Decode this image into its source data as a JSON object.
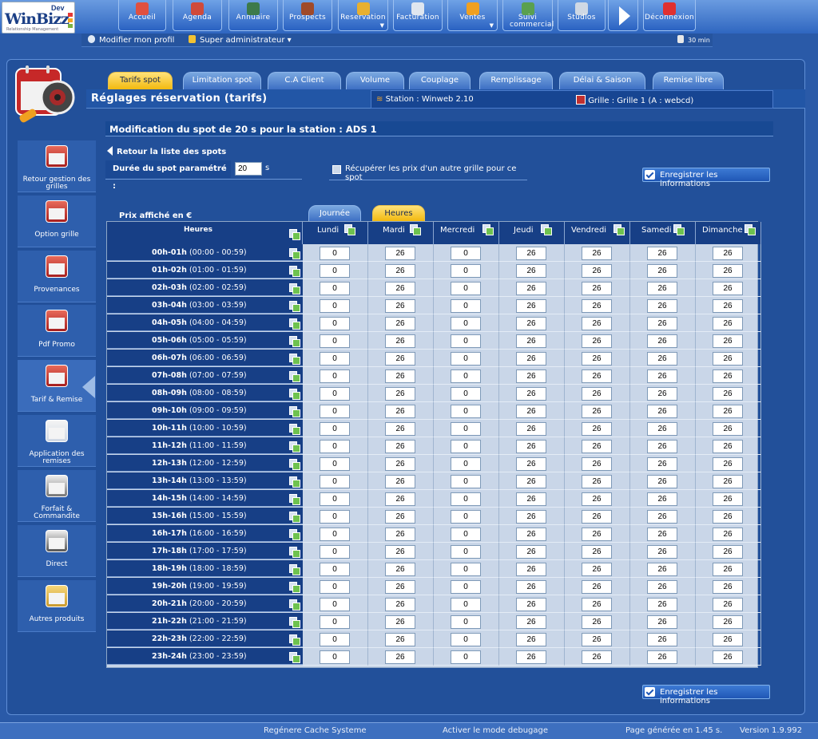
{
  "app": {
    "name": "WinBizz",
    "dev_label": "Dev",
    "tagline": "Relationship Management"
  },
  "nav": [
    {
      "label": "Accueil",
      "icon": "home-icon",
      "color": "#e05040"
    },
    {
      "label": "Agenda",
      "icon": "calendar-icon",
      "color": "#d04a3a"
    },
    {
      "label": "Annuaire",
      "icon": "address-book-icon",
      "color": "#3d7a4a"
    },
    {
      "label": "Prospects",
      "icon": "briefcase-icon",
      "color": "#a04a2a"
    },
    {
      "label": "Reservation",
      "icon": "stopwatch-icon",
      "color": "#e8b030"
    },
    {
      "label": "Facturation",
      "icon": "invoice-icon",
      "color": "#dfe6ef"
    },
    {
      "label": "Ventes",
      "icon": "sales-icon",
      "color": "#f0a020"
    },
    {
      "label": "Suivi commercial",
      "icon": "followup-icon",
      "color": "#5aa050"
    },
    {
      "label": "Studios",
      "icon": "studio-icon",
      "color": "#cfd8e4"
    },
    {
      "label": "Déconnexion",
      "icon": "power-icon",
      "color": "#e03030"
    }
  ],
  "userbar": {
    "profile": "Modifier mon profil",
    "role": "Super administrateur",
    "session": "30 min"
  },
  "tabs": [
    "Tarifs spot",
    "Limitation spot",
    "C.A Client",
    "Volume",
    "Couplage",
    "Remplissage",
    "Délai & Saison",
    "Remise libre"
  ],
  "page_title": "Réglages réservation (tarifs)",
  "station": "Station : Winweb 2.10",
  "grille": "Grille : Grille 1 (A : webcd)",
  "sidebar": [
    {
      "label": "Retour gestion des grilles"
    },
    {
      "label": "Option grille"
    },
    {
      "label": "Provenances"
    },
    {
      "label": "Pdf Promo"
    },
    {
      "label": "Tarif & Remise"
    },
    {
      "label": "Application des remises"
    },
    {
      "label": "Forfait & Commandite"
    },
    {
      "label": "Direct"
    },
    {
      "label": "Autres produits"
    }
  ],
  "content": {
    "title": "Modification du spot de 20 s pour la station : ADS 1",
    "back": "Retour la liste des spots",
    "duree_label": "Durée du spot paramétré :",
    "duree_value": "20",
    "duree_unit": "s",
    "recup": "Récupérer les prix d'un autre grille pour ce spot",
    "save": "Enregistrer les informations",
    "prix_label": "Prix affiché en €",
    "mode_tabs": [
      "Journée",
      "Heures"
    ]
  },
  "grid": {
    "hour_header": "Heures",
    "days": [
      "Lundi",
      "Mardi",
      "Mercredi",
      "Jeudi",
      "Vendredi",
      "Samedi",
      "Dimanche"
    ],
    "rows": [
      {
        "slot": "00h-01h",
        "range": "(00:00 - 00:59)",
        "values": [
          "0",
          "26",
          "0",
          "26",
          "26",
          "26",
          "26"
        ]
      },
      {
        "slot": "01h-02h",
        "range": "(01:00 - 01:59)",
        "values": [
          "0",
          "26",
          "0",
          "26",
          "26",
          "26",
          "26"
        ]
      },
      {
        "slot": "02h-03h",
        "range": "(02:00 - 02:59)",
        "values": [
          "0",
          "26",
          "0",
          "26",
          "26",
          "26",
          "26"
        ]
      },
      {
        "slot": "03h-04h",
        "range": "(03:00 - 03:59)",
        "values": [
          "0",
          "26",
          "0",
          "26",
          "26",
          "26",
          "26"
        ]
      },
      {
        "slot": "04h-05h",
        "range": "(04:00 - 04:59)",
        "values": [
          "0",
          "26",
          "0",
          "26",
          "26",
          "26",
          "26"
        ]
      },
      {
        "slot": "05h-06h",
        "range": "(05:00 - 05:59)",
        "values": [
          "0",
          "26",
          "0",
          "26",
          "26",
          "26",
          "26"
        ]
      },
      {
        "slot": "06h-07h",
        "range": "(06:00 - 06:59)",
        "values": [
          "0",
          "26",
          "0",
          "26",
          "26",
          "26",
          "26"
        ]
      },
      {
        "slot": "07h-08h",
        "range": "(07:00 - 07:59)",
        "values": [
          "0",
          "26",
          "0",
          "26",
          "26",
          "26",
          "26"
        ]
      },
      {
        "slot": "08h-09h",
        "range": "(08:00 - 08:59)",
        "values": [
          "0",
          "26",
          "0",
          "26",
          "26",
          "26",
          "26"
        ]
      },
      {
        "slot": "09h-10h",
        "range": "(09:00 - 09:59)",
        "values": [
          "0",
          "26",
          "0",
          "26",
          "26",
          "26",
          "26"
        ]
      },
      {
        "slot": "10h-11h",
        "range": "(10:00 - 10:59)",
        "values": [
          "0",
          "26",
          "0",
          "26",
          "26",
          "26",
          "26"
        ]
      },
      {
        "slot": "11h-12h",
        "range": "(11:00 - 11:59)",
        "values": [
          "0",
          "26",
          "0",
          "26",
          "26",
          "26",
          "26"
        ]
      },
      {
        "slot": "12h-13h",
        "range": "(12:00 - 12:59)",
        "values": [
          "0",
          "26",
          "0",
          "26",
          "26",
          "26",
          "26"
        ]
      },
      {
        "slot": "13h-14h",
        "range": "(13:00 - 13:59)",
        "values": [
          "0",
          "26",
          "0",
          "26",
          "26",
          "26",
          "26"
        ]
      },
      {
        "slot": "14h-15h",
        "range": "(14:00 - 14:59)",
        "values": [
          "0",
          "26",
          "0",
          "26",
          "26",
          "26",
          "26"
        ]
      },
      {
        "slot": "15h-16h",
        "range": "(15:00 - 15:59)",
        "values": [
          "0",
          "26",
          "0",
          "26",
          "26",
          "26",
          "26"
        ]
      },
      {
        "slot": "16h-17h",
        "range": "(16:00 - 16:59)",
        "values": [
          "0",
          "26",
          "0",
          "26",
          "26",
          "26",
          "26"
        ]
      },
      {
        "slot": "17h-18h",
        "range": "(17:00 - 17:59)",
        "values": [
          "0",
          "26",
          "0",
          "26",
          "26",
          "26",
          "26"
        ]
      },
      {
        "slot": "18h-19h",
        "range": "(18:00 - 18:59)",
        "values": [
          "0",
          "26",
          "0",
          "26",
          "26",
          "26",
          "26"
        ]
      },
      {
        "slot": "19h-20h",
        "range": "(19:00 - 19:59)",
        "values": [
          "0",
          "26",
          "0",
          "26",
          "26",
          "26",
          "26"
        ]
      },
      {
        "slot": "20h-21h",
        "range": "(20:00 - 20:59)",
        "values": [
          "0",
          "26",
          "0",
          "26",
          "26",
          "26",
          "26"
        ]
      },
      {
        "slot": "21h-22h",
        "range": "(21:00 - 21:59)",
        "values": [
          "0",
          "26",
          "0",
          "26",
          "26",
          "26",
          "26"
        ]
      },
      {
        "slot": "22h-23h",
        "range": "(22:00 - 22:59)",
        "values": [
          "0",
          "26",
          "0",
          "26",
          "26",
          "26",
          "26"
        ]
      },
      {
        "slot": "23h-24h",
        "range": "(23:00 - 23:59)",
        "values": [
          "0",
          "26",
          "0",
          "26",
          "26",
          "26",
          "26"
        ]
      }
    ]
  },
  "footer": {
    "cache": "Regénere Cache Systeme",
    "debug": "Activer le mode debugage",
    "generated": "Page générée en 1.45 s.",
    "version": "Version 1.9.992"
  },
  "colors": {
    "accent": "#f2b90f",
    "header_bg": "#173f86",
    "page_bg": "#2a5aa8"
  }
}
